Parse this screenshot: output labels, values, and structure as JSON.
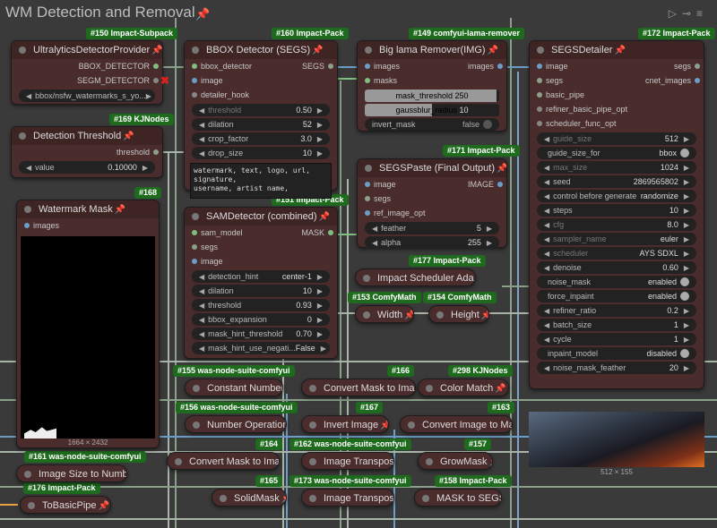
{
  "group": {
    "title": "WM Detection and Removal",
    "tool_icons": [
      "play-icon",
      "link-icon",
      "menu-icon"
    ]
  },
  "badges": {
    "b150": "#150 Impact-Subpack",
    "b160": "#160 Impact-Pack",
    "b149": "#149 comfyui-lama-remover",
    "b172": "#172 Impact-Pack",
    "b169": "#169 KJNodes",
    "b168": "#168",
    "b151": "#151 Impact-Pack",
    "b171": "#171 Impact-Pack",
    "b177": "#177 Impact-Pack",
    "b153": "#153 ComfyMath",
    "b154": "#154 ComfyMath",
    "b155": "#155 was-node-suite-comfyui",
    "b166": "#166",
    "b298": "#298 KJNodes",
    "b156": "#156 was-node-suite-comfyui",
    "b167": "#167",
    "b163": "#163",
    "b161": "#161 was-node-suite-comfyui",
    "b164": "#164",
    "b162": "#162 was-node-suite-comfyui",
    "b157": "#157",
    "b176": "#176 Impact-Pack",
    "b165": "#165",
    "b173": "#173 was-node-suite-comfyui",
    "b158": "#158 Impact-Pack"
  },
  "nodes": {
    "ultralytics": {
      "title": "UltralyticsDetectorProvider",
      "out1": "BBOX_DETECTOR",
      "out2": "SEGM_DETECTOR",
      "model": "bbox/nsfw_watermarks_s_yo..."
    },
    "bbox": {
      "title": "BBOX Detector (SEGS)",
      "in1": "bbox_detector",
      "out1": "SEGS",
      "in2": "image",
      "in3": "detailer_hook",
      "w": [
        {
          "label": "threshold",
          "value": "0.50",
          "dim": true
        },
        {
          "label": "dilation",
          "value": "52"
        },
        {
          "label": "crop_factor",
          "value": "3.0"
        },
        {
          "label": "drop_size",
          "value": "10"
        }
      ],
      "text": "watermark, text, logo, url, signature,\nusername, artist name,"
    },
    "lama": {
      "title": "Big lama Remover(IMG)",
      "in1": "images",
      "out1": "images",
      "in2": "masks",
      "s1_label": "mask_threshold",
      "s1_value": "250",
      "s1_frac": 0.98,
      "s2_label": "gaussblur_radius",
      "s2_value": "10",
      "s2_frac": 0.5,
      "toggle_label": "invert_mask",
      "toggle_value": "false"
    },
    "segsd": {
      "title": "SEGSDetailer",
      "in1": "image",
      "out1": "segs",
      "in2": "segs",
      "out2": "cnet_images",
      "in3": "basic_pipe",
      "in4": "refiner_basic_pipe_opt",
      "in5": "scheduler_func_opt",
      "w": [
        {
          "label": "guide_size",
          "value": "512",
          "dim": true
        },
        {
          "label": "guide_size_for",
          "value": "bbox",
          "toggle": true
        },
        {
          "label": "max_size",
          "value": "1024",
          "dim": true
        },
        {
          "label": "seed",
          "value": "2869565802"
        },
        {
          "label": "control before generate",
          "value": "randomize"
        },
        {
          "label": "steps",
          "value": "10"
        },
        {
          "label": "cfg",
          "value": "8.0",
          "dim": true
        },
        {
          "label": "sampler_name",
          "value": "euler",
          "dim": true
        },
        {
          "label": "scheduler",
          "value": "AYS SDXL",
          "dim": true
        },
        {
          "label": "denoise",
          "value": "0.60"
        },
        {
          "label": "noise_mask",
          "value": "enabled",
          "toggle": true
        },
        {
          "label": "force_inpaint",
          "value": "enabled",
          "toggle": true
        },
        {
          "label": "refiner_ratio",
          "value": "0.2"
        },
        {
          "label": "batch_size",
          "value": "1"
        },
        {
          "label": "cycle",
          "value": "1"
        },
        {
          "label": "inpaint_model",
          "value": "disabled",
          "toggle": true
        },
        {
          "label": "noise_mask_feather",
          "value": "20"
        }
      ],
      "caption": "512 × 155"
    },
    "threshold": {
      "title": "Detection Threshold",
      "out1": "threshold",
      "w_label": "value",
      "w_value": "0.10000"
    },
    "wmmask": {
      "title": "Watermark Mask",
      "in1": "images",
      "caption": "1664 × 2432"
    },
    "sam": {
      "title": "SAMDetector (combined)",
      "in1": "sam_model",
      "out1": "MASK",
      "in2": "segs",
      "in3": "image",
      "w": [
        {
          "label": "detection_hint",
          "value": "center-1"
        },
        {
          "label": "dilation",
          "value": "10"
        },
        {
          "label": "threshold",
          "value": "0.93"
        },
        {
          "label": "bbox_expansion",
          "value": "0"
        },
        {
          "label": "mask_hint_threshold",
          "value": "0.70"
        },
        {
          "label": "mask_hint_use_negati...",
          "value": "False"
        }
      ]
    },
    "paste": {
      "title": "SEGSPaste (Final Output)",
      "in1": "image",
      "out1": "IMAGE",
      "in2": "segs",
      "in3": "ref_image_opt",
      "w": [
        {
          "label": "feather",
          "value": "5"
        },
        {
          "label": "alpha",
          "value": "255"
        }
      ]
    },
    "collapsed": {
      "impact_sched": "Impact Scheduler Ada",
      "width": "Width",
      "height": "Height",
      "const_number": "Constant Number",
      "conv_mask_img1": "Convert Mask to Imag",
      "color_match": "Color Match",
      "number_op": "Number Operation",
      "invert_image": "Invert Image",
      "conv_img_mask": "Convert Image to Mas",
      "img_size_num": "Image Size to Number",
      "conv_mask_img2": "Convert Mask to Imag",
      "img_transpose1": "Image Transpose",
      "grow_mask": "GrowMask",
      "to_basic_pipe": "ToBasicPipe",
      "solid_mask": "SolidMask",
      "img_transpose2": "Image Transpose",
      "mask_to_segs": "MASK to SEGS"
    }
  },
  "colors": {
    "node_bg": "#4a2c2c",
    "badge": "#1e6b1e",
    "pin": "#e0457a",
    "wire_image": "#6a9ec8",
    "wire_mask": "#7fbf7f",
    "wire_gray": "#9aa59a"
  }
}
